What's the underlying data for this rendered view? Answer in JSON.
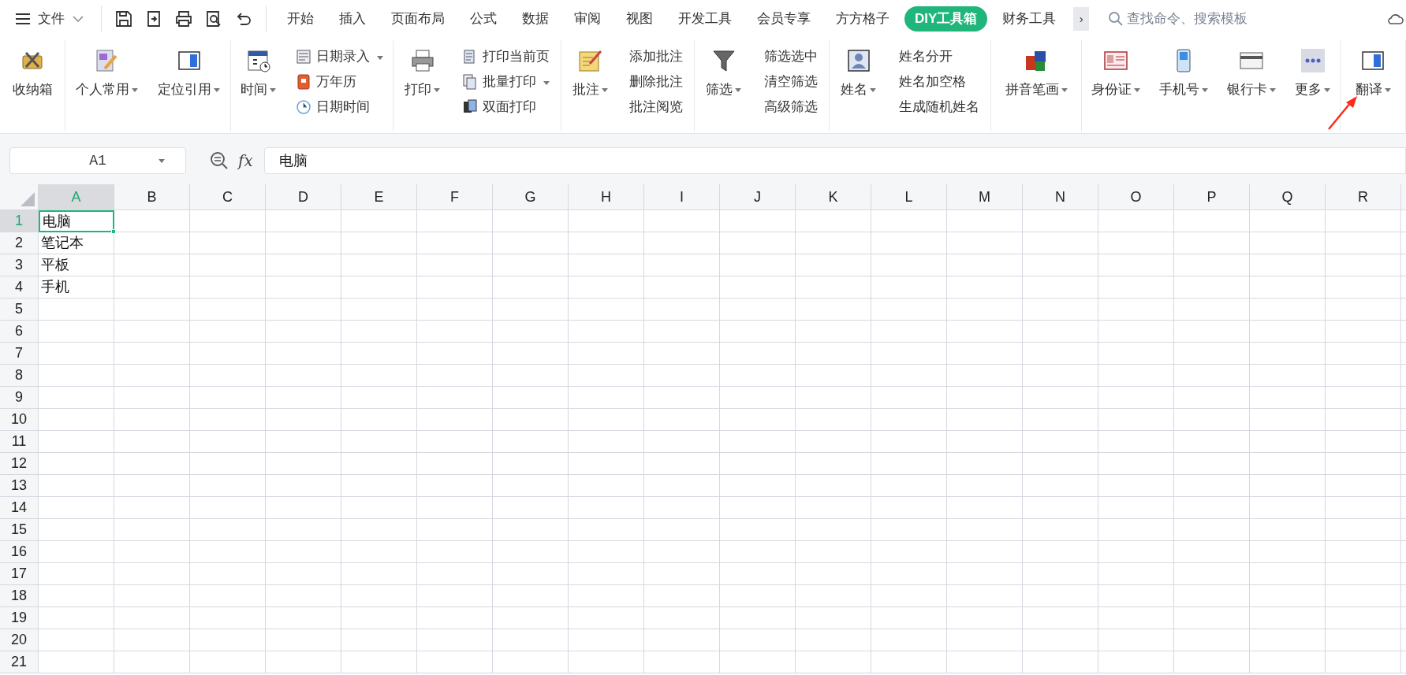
{
  "top_bar": {
    "file_menu": {
      "label": "文件"
    },
    "tabs": [
      {
        "label": "开始",
        "selected": false
      },
      {
        "label": "插入",
        "selected": false
      },
      {
        "label": "页面布局",
        "selected": false
      },
      {
        "label": "公式",
        "selected": false
      },
      {
        "label": "数据",
        "selected": false
      },
      {
        "label": "审阅",
        "selected": false
      },
      {
        "label": "视图",
        "selected": false
      },
      {
        "label": "开发工具",
        "selected": false
      },
      {
        "label": "会员专享",
        "selected": false
      },
      {
        "label": "方方格子",
        "selected": false
      },
      {
        "label": "DIY工具箱",
        "selected": true
      },
      {
        "label": "财务工具",
        "selected": false
      }
    ],
    "more_tabs": "›",
    "search": {
      "placeholder": "查找命令、搜索模板"
    }
  },
  "ribbon": {
    "groups": [
      {
        "items": [
          {
            "kind": "large",
            "label": "收纳箱",
            "dropdown": false
          }
        ]
      },
      {
        "items": [
          {
            "kind": "large",
            "label": "个人常用",
            "dropdown": true
          },
          {
            "kind": "large",
            "label": "定位引用",
            "dropdown": true
          }
        ]
      },
      {
        "items": [
          {
            "kind": "large",
            "label": "时间",
            "dropdown": true
          },
          {
            "kind": "stack",
            "items": [
              {
                "label": "日期录入",
                "dropdown": true
              },
              {
                "label": "万年历",
                "dropdown": false
              },
              {
                "label": "日期时间",
                "dropdown": false
              }
            ]
          }
        ]
      },
      {
        "items": [
          {
            "kind": "large",
            "label": "打印",
            "dropdown": true
          },
          {
            "kind": "stack",
            "items": [
              {
                "label": "打印当前页",
                "dropdown": false
              },
              {
                "label": "批量打印",
                "dropdown": true
              },
              {
                "label": "双面打印",
                "dropdown": false
              }
            ]
          }
        ]
      },
      {
        "items": [
          {
            "kind": "large",
            "label": "批注",
            "dropdown": true
          },
          {
            "kind": "stack",
            "items": [
              {
                "label": "添加批注",
                "dropdown": false
              },
              {
                "label": "删除批注",
                "dropdown": false
              },
              {
                "label": "批注阅览",
                "dropdown": false
              }
            ]
          }
        ]
      },
      {
        "items": [
          {
            "kind": "large",
            "label": "筛选",
            "dropdown": true
          },
          {
            "kind": "stack",
            "items": [
              {
                "label": "筛选选中",
                "dropdown": false
              },
              {
                "label": "清空筛选",
                "dropdown": false
              },
              {
                "label": "高级筛选",
                "dropdown": false
              }
            ]
          }
        ]
      },
      {
        "items": [
          {
            "kind": "large",
            "label": "姓名",
            "dropdown": true
          },
          {
            "kind": "stack",
            "items": [
              {
                "label": "姓名分开",
                "dropdown": false
              },
              {
                "label": "姓名加空格",
                "dropdown": false
              },
              {
                "label": "生成随机姓名",
                "dropdown": false
              }
            ]
          }
        ]
      },
      {
        "items": [
          {
            "kind": "large",
            "label": "拼音笔画",
            "dropdown": true
          }
        ]
      },
      {
        "items": [
          {
            "kind": "large",
            "label": "身份证",
            "dropdown": true
          },
          {
            "kind": "large",
            "label": "手机号",
            "dropdown": true
          },
          {
            "kind": "large",
            "label": "银行卡",
            "dropdown": true
          },
          {
            "kind": "large",
            "label": "更多",
            "dropdown": true
          }
        ]
      },
      {
        "items": [
          {
            "kind": "large",
            "label": "翻译",
            "dropdown": true
          }
        ]
      }
    ]
  },
  "formula_bar": {
    "name_box": "A1",
    "fx_label": "fx",
    "formula": "电脑"
  },
  "sheet": {
    "columns": [
      {
        "label": "A",
        "selected": true
      },
      {
        "label": "B",
        "selected": false
      },
      {
        "label": "C",
        "selected": false
      },
      {
        "label": "D",
        "selected": false
      },
      {
        "label": "E",
        "selected": false
      },
      {
        "label": "F",
        "selected": false
      },
      {
        "label": "G",
        "selected": false
      },
      {
        "label": "H",
        "selected": false
      },
      {
        "label": "I",
        "selected": false
      },
      {
        "label": "J",
        "selected": false
      },
      {
        "label": "K",
        "selected": false
      },
      {
        "label": "L",
        "selected": false
      },
      {
        "label": "M",
        "selected": false
      },
      {
        "label": "N",
        "selected": false
      },
      {
        "label": "O",
        "selected": false
      },
      {
        "label": "P",
        "selected": false
      },
      {
        "label": "Q",
        "selected": false
      },
      {
        "label": "R",
        "selected": false
      }
    ],
    "rows": [
      {
        "label": "1",
        "selected": true,
        "cells": [
          "电脑"
        ]
      },
      {
        "label": "2",
        "selected": false,
        "cells": [
          "笔记本"
        ]
      },
      {
        "label": "3",
        "selected": false,
        "cells": [
          "平板"
        ]
      },
      {
        "label": "4",
        "selected": false,
        "cells": [
          "手机"
        ]
      },
      {
        "label": "5",
        "selected": false
      },
      {
        "label": "6",
        "selected": false
      },
      {
        "label": "7",
        "selected": false
      },
      {
        "label": "8",
        "selected": false
      },
      {
        "label": "9",
        "selected": false
      },
      {
        "label": "10",
        "selected": false
      },
      {
        "label": "11",
        "selected": false
      },
      {
        "label": "12",
        "selected": false
      },
      {
        "label": "13",
        "selected": false
      },
      {
        "label": "14",
        "selected": false
      },
      {
        "label": "15",
        "selected": false
      },
      {
        "label": "16",
        "selected": false
      },
      {
        "label": "17",
        "selected": false
      },
      {
        "label": "18",
        "selected": false
      },
      {
        "label": "19",
        "selected": false
      },
      {
        "label": "20",
        "selected": false
      },
      {
        "label": "21",
        "selected": false
      }
    ]
  }
}
